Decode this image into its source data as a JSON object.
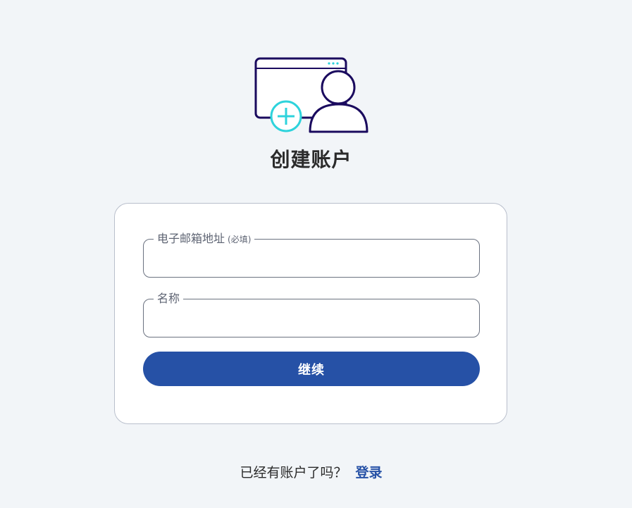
{
  "page_title": "创建账户",
  "form": {
    "email": {
      "label": "电子邮箱地址",
      "required_hint": "(必填)",
      "value": "",
      "placeholder": ""
    },
    "name": {
      "label": "名称",
      "value": "",
      "placeholder": ""
    },
    "continue_label": "继续"
  },
  "footer": {
    "prompt": "已经有账户了吗？",
    "login_label": "登录"
  },
  "colors": {
    "background": "#f2f5f8",
    "primary": "#2651a6",
    "illustration_outline": "#1a0a5e",
    "illustration_accent": "#2ed3dc"
  },
  "icons": {
    "hero": "add-user-window-illustration"
  }
}
